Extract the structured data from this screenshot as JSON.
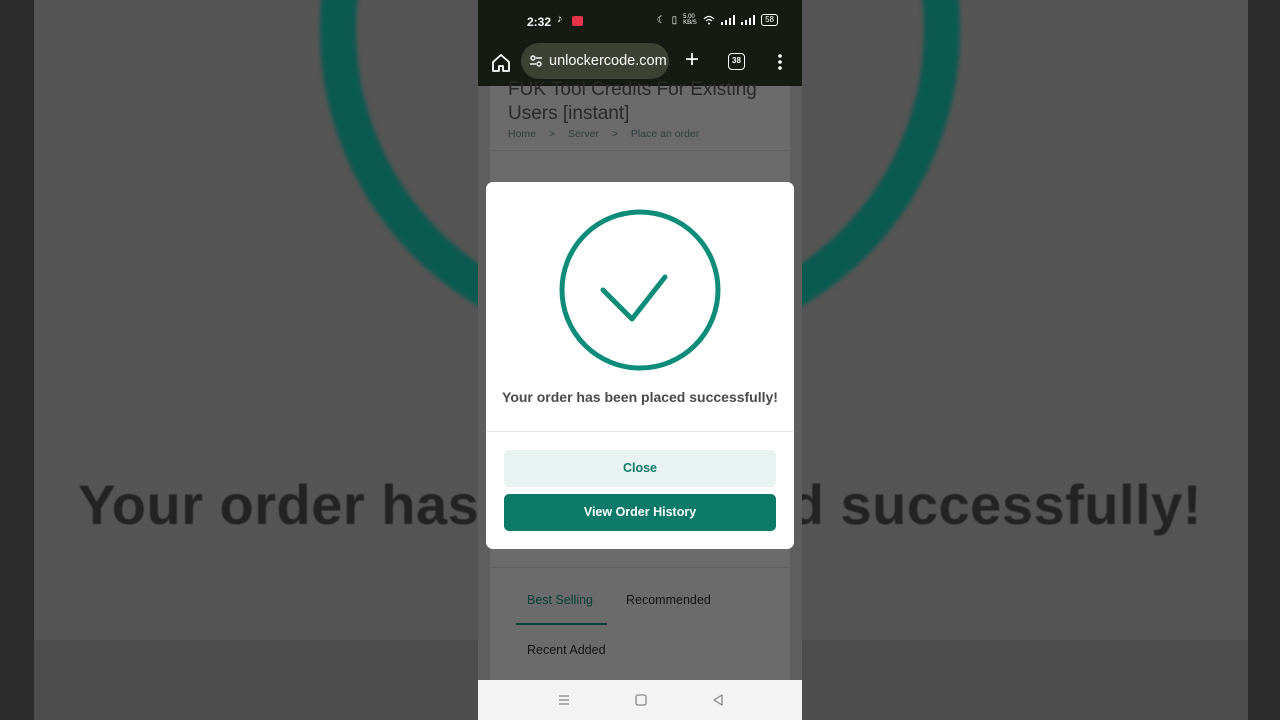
{
  "background": {
    "zoomed_text": "Your order has been placed successfully!"
  },
  "status_bar": {
    "time": "2:32",
    "net_speed": "5.00 KB/S",
    "battery": "58"
  },
  "browser": {
    "url": "unlockercode.com",
    "tab_count": "38"
  },
  "page": {
    "title": "FUK Tool Credits For Existing Users [instant]",
    "breadcrumb": [
      "Home",
      ">",
      "Server",
      ">",
      "Place an order"
    ],
    "tabs": [
      {
        "label": "Best Selling",
        "active": true
      },
      {
        "label": "Recommended",
        "active": false
      },
      {
        "label": "Recent Added",
        "active": false
      }
    ]
  },
  "modal": {
    "message": "Your order has been placed successfully!",
    "close_label": "Close",
    "history_label": "View Order History",
    "accent_color": "#0b7a69"
  },
  "nav_bar": {
    "icons": [
      "menu-icon",
      "square-icon",
      "back-triangle-icon"
    ]
  }
}
